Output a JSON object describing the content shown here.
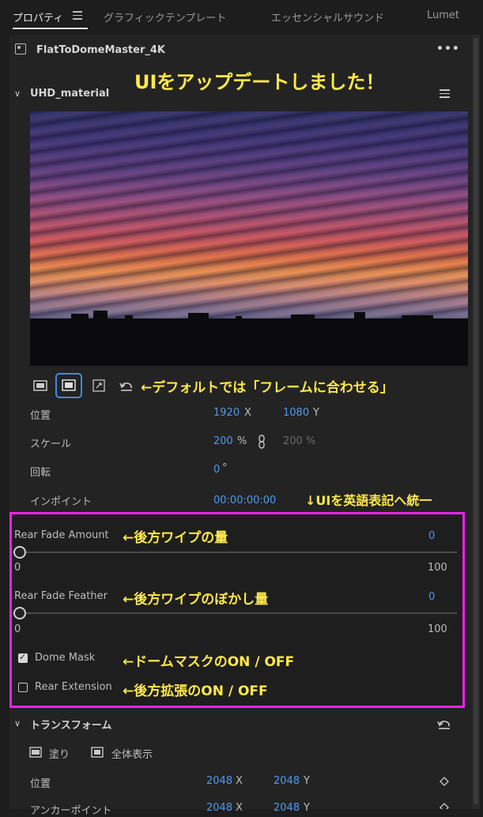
{
  "tabs": [
    {
      "label": "プロパティ",
      "active": true
    },
    {
      "label": "グラフィックテンプレート",
      "active": false
    },
    {
      "label": "エッセンシャルサウンド",
      "active": false
    },
    {
      "label": "Lumet",
      "active": false
    }
  ],
  "clip": {
    "name": "FlatToDomeMaster_4K",
    "more_label": "•••"
  },
  "headline_annotation": "UIをアップデートしました！",
  "section_uhd": {
    "title": "UHD_material"
  },
  "fit_annotation": "←デフォルトでは「フレームに合わせる」",
  "position": {
    "label": "位置",
    "x": "1920",
    "x_unit": "X",
    "y": "1080",
    "y_unit": "Y"
  },
  "scale": {
    "label": "スケール",
    "value": "200",
    "unit": "%",
    "value2": "200",
    "unit2": "%"
  },
  "rotation": {
    "label": "回転",
    "value": "0",
    "unit": "°"
  },
  "inpoint": {
    "label": "インポイント",
    "value": "00:00:00:00"
  },
  "unify_annotation": "↓UIを英語表記へ統一",
  "rear_fade_amount": {
    "label": "Rear Fade Amount",
    "annotation": "←後方ワイプの量",
    "value": "0",
    "min": "0",
    "max": "100",
    "level": 0
  },
  "rear_fade_feather": {
    "label": "Rear Fade Feather",
    "annotation": "←後方ワイプのぼかし量",
    "value": "0",
    "min": "0",
    "max": "100",
    "level": 0
  },
  "dome_mask": {
    "label": "Dome Mask",
    "checked": true,
    "annotation": "←ドームマスクのON / OFF"
  },
  "rear_extension": {
    "label": "Rear Extension",
    "checked": false,
    "annotation": "←後方拡張のON / OFF"
  },
  "transform": {
    "title": "トランスフォーム",
    "fill_label": "塗り",
    "fit_label": "全体表示",
    "position": {
      "label": "位置",
      "x": "2048",
      "x_unit": "X",
      "y": "2048",
      "y_unit": "Y"
    },
    "anchor": {
      "label": "アンカーポイント",
      "x": "2048",
      "x_unit": "X",
      "y": "2048",
      "y_unit": "Y"
    }
  },
  "colors": {
    "accent_blue": "#4e9bf0",
    "annotation_yellow": "#ffe94a",
    "highlight_magenta": "#ee22ee"
  }
}
